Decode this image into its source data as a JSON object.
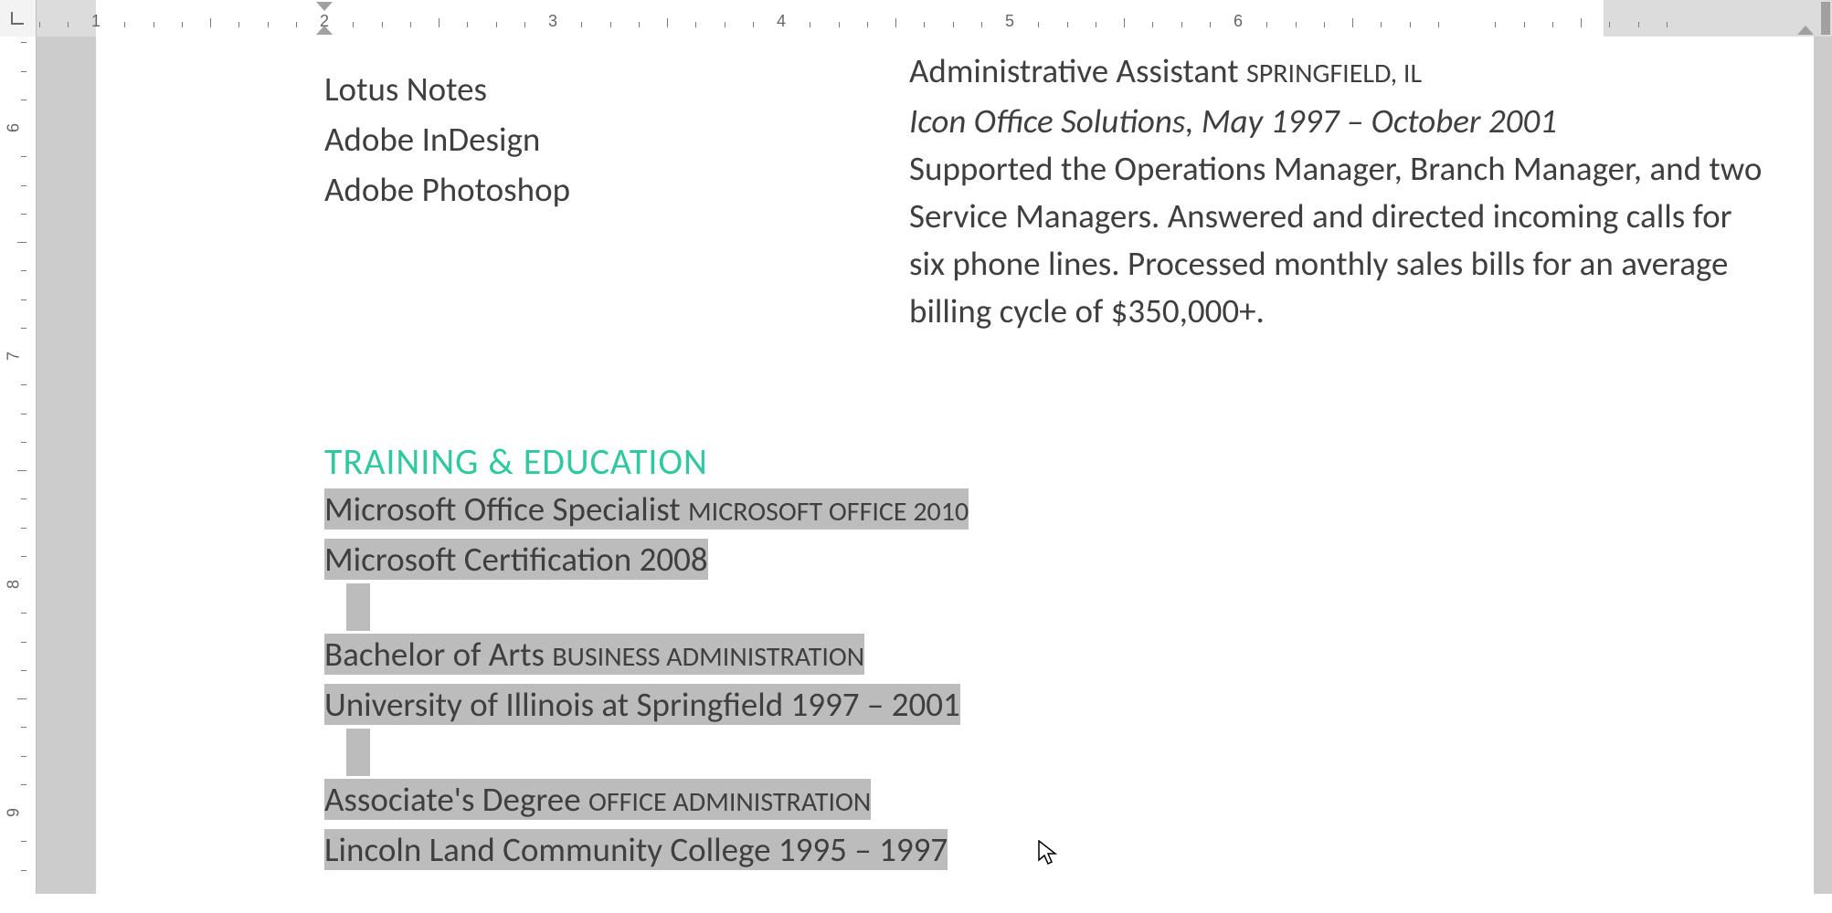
{
  "ruler": {
    "h_numbers": [
      "1",
      "2",
      "3",
      "4",
      "5",
      "6"
    ],
    "v_numbers": [
      "6",
      "7",
      "8",
      "9"
    ]
  },
  "left_col": {
    "skills": [
      "Lotus Notes",
      "Adobe InDesign",
      "Adobe Photoshop"
    ]
  },
  "right_col": {
    "job_title": "Administrative Assistant",
    "job_location": "SPRINGFIELD, IL",
    "job_company": "Icon Office Solutions, May 1997 – October 2001",
    "job_desc": "Supported the Operations Manager, Branch Manager, and two Service Managers. Answered and directed incoming calls for six phone lines. Processed monthly sales bills for an average billing cycle of $350,000+."
  },
  "education": {
    "heading": "TRAINING & EDUCATION",
    "items": [
      {
        "title": "Microsoft Office Specialist",
        "sub": "MICROSOFT OFFICE 2010",
        "line2": "Microsoft Certification 2008"
      },
      {
        "title": "Bachelor of Arts",
        "sub": "BUSINESS ADMINISTRATION",
        "line2": "University of Illinois at Springfield 1997 – 2001"
      },
      {
        "title": "Associate's Degree",
        "sub": "OFFICE ADMINISTRATION",
        "line2": "Lincoln Land Community College 1995 – 1997"
      }
    ]
  }
}
